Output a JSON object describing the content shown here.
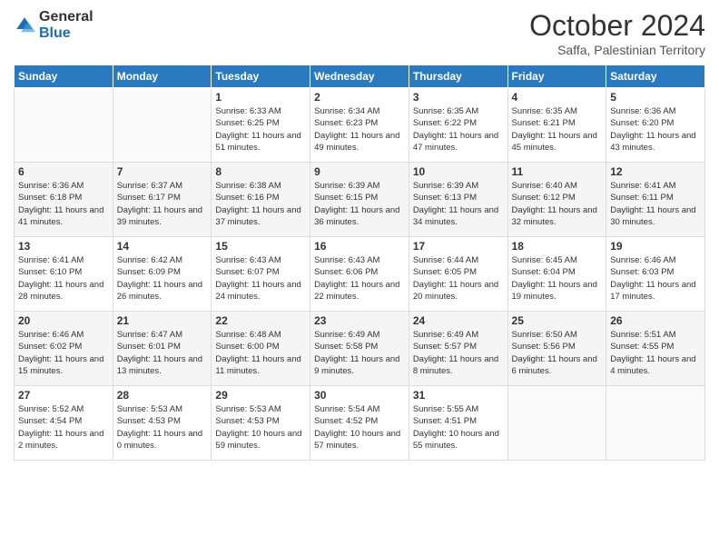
{
  "logo": {
    "general": "General",
    "blue": "Blue"
  },
  "header": {
    "month": "October 2024",
    "location": "Saffa, Palestinian Territory"
  },
  "weekdays": [
    "Sunday",
    "Monday",
    "Tuesday",
    "Wednesday",
    "Thursday",
    "Friday",
    "Saturday"
  ],
  "weeks": [
    [
      {
        "day": "",
        "info": ""
      },
      {
        "day": "",
        "info": ""
      },
      {
        "day": "1",
        "info": "Sunrise: 6:33 AM\nSunset: 6:25 PM\nDaylight: 11 hours and 51 minutes."
      },
      {
        "day": "2",
        "info": "Sunrise: 6:34 AM\nSunset: 6:23 PM\nDaylight: 11 hours and 49 minutes."
      },
      {
        "day": "3",
        "info": "Sunrise: 6:35 AM\nSunset: 6:22 PM\nDaylight: 11 hours and 47 minutes."
      },
      {
        "day": "4",
        "info": "Sunrise: 6:35 AM\nSunset: 6:21 PM\nDaylight: 11 hours and 45 minutes."
      },
      {
        "day": "5",
        "info": "Sunrise: 6:36 AM\nSunset: 6:20 PM\nDaylight: 11 hours and 43 minutes."
      }
    ],
    [
      {
        "day": "6",
        "info": "Sunrise: 6:36 AM\nSunset: 6:18 PM\nDaylight: 11 hours and 41 minutes."
      },
      {
        "day": "7",
        "info": "Sunrise: 6:37 AM\nSunset: 6:17 PM\nDaylight: 11 hours and 39 minutes."
      },
      {
        "day": "8",
        "info": "Sunrise: 6:38 AM\nSunset: 6:16 PM\nDaylight: 11 hours and 37 minutes."
      },
      {
        "day": "9",
        "info": "Sunrise: 6:39 AM\nSunset: 6:15 PM\nDaylight: 11 hours and 36 minutes."
      },
      {
        "day": "10",
        "info": "Sunrise: 6:39 AM\nSunset: 6:13 PM\nDaylight: 11 hours and 34 minutes."
      },
      {
        "day": "11",
        "info": "Sunrise: 6:40 AM\nSunset: 6:12 PM\nDaylight: 11 hours and 32 minutes."
      },
      {
        "day": "12",
        "info": "Sunrise: 6:41 AM\nSunset: 6:11 PM\nDaylight: 11 hours and 30 minutes."
      }
    ],
    [
      {
        "day": "13",
        "info": "Sunrise: 6:41 AM\nSunset: 6:10 PM\nDaylight: 11 hours and 28 minutes."
      },
      {
        "day": "14",
        "info": "Sunrise: 6:42 AM\nSunset: 6:09 PM\nDaylight: 11 hours and 26 minutes."
      },
      {
        "day": "15",
        "info": "Sunrise: 6:43 AM\nSunset: 6:07 PM\nDaylight: 11 hours and 24 minutes."
      },
      {
        "day": "16",
        "info": "Sunrise: 6:43 AM\nSunset: 6:06 PM\nDaylight: 11 hours and 22 minutes."
      },
      {
        "day": "17",
        "info": "Sunrise: 6:44 AM\nSunset: 6:05 PM\nDaylight: 11 hours and 20 minutes."
      },
      {
        "day": "18",
        "info": "Sunrise: 6:45 AM\nSunset: 6:04 PM\nDaylight: 11 hours and 19 minutes."
      },
      {
        "day": "19",
        "info": "Sunrise: 6:46 AM\nSunset: 6:03 PM\nDaylight: 11 hours and 17 minutes."
      }
    ],
    [
      {
        "day": "20",
        "info": "Sunrise: 6:46 AM\nSunset: 6:02 PM\nDaylight: 11 hours and 15 minutes."
      },
      {
        "day": "21",
        "info": "Sunrise: 6:47 AM\nSunset: 6:01 PM\nDaylight: 11 hours and 13 minutes."
      },
      {
        "day": "22",
        "info": "Sunrise: 6:48 AM\nSunset: 6:00 PM\nDaylight: 11 hours and 11 minutes."
      },
      {
        "day": "23",
        "info": "Sunrise: 6:49 AM\nSunset: 5:58 PM\nDaylight: 11 hours and 9 minutes."
      },
      {
        "day": "24",
        "info": "Sunrise: 6:49 AM\nSunset: 5:57 PM\nDaylight: 11 hours and 8 minutes."
      },
      {
        "day": "25",
        "info": "Sunrise: 6:50 AM\nSunset: 5:56 PM\nDaylight: 11 hours and 6 minutes."
      },
      {
        "day": "26",
        "info": "Sunrise: 5:51 AM\nSunset: 4:55 PM\nDaylight: 11 hours and 4 minutes."
      }
    ],
    [
      {
        "day": "27",
        "info": "Sunrise: 5:52 AM\nSunset: 4:54 PM\nDaylight: 11 hours and 2 minutes."
      },
      {
        "day": "28",
        "info": "Sunrise: 5:53 AM\nSunset: 4:53 PM\nDaylight: 11 hours and 0 minutes."
      },
      {
        "day": "29",
        "info": "Sunrise: 5:53 AM\nSunset: 4:53 PM\nDaylight: 10 hours and 59 minutes."
      },
      {
        "day": "30",
        "info": "Sunrise: 5:54 AM\nSunset: 4:52 PM\nDaylight: 10 hours and 57 minutes."
      },
      {
        "day": "31",
        "info": "Sunrise: 5:55 AM\nSunset: 4:51 PM\nDaylight: 10 hours and 55 minutes."
      },
      {
        "day": "",
        "info": ""
      },
      {
        "day": "",
        "info": ""
      }
    ]
  ]
}
